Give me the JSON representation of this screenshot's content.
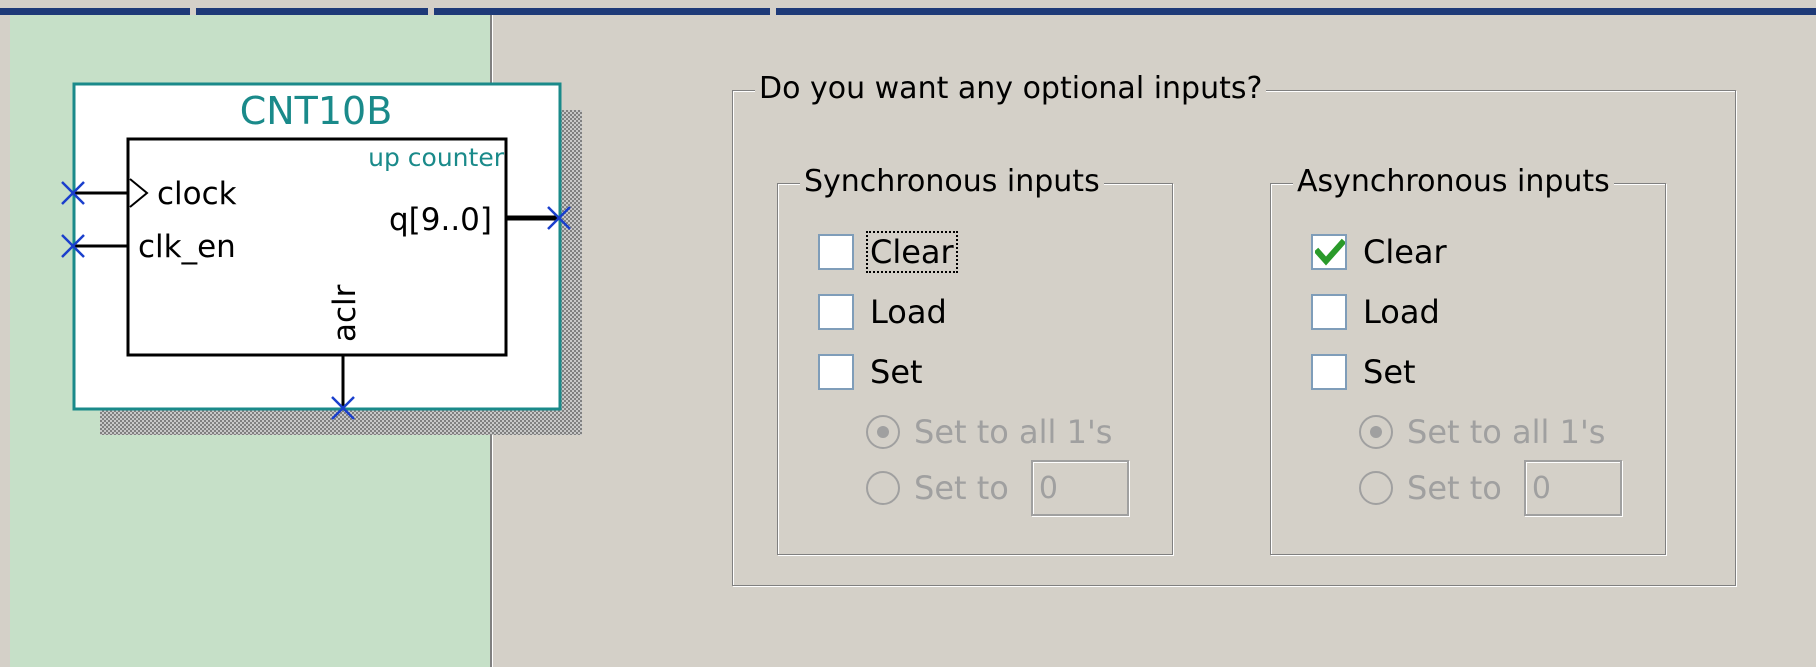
{
  "symbol": {
    "name": "CNT10B",
    "type": "up counter",
    "ports": {
      "clock": "clock",
      "clk_en": "clk_en",
      "output": "q[9..0]",
      "aclr": "aclr"
    }
  },
  "options": {
    "title": "Do you want any optional inputs?",
    "synchronous": {
      "title": "Synchronous inputs",
      "clear": {
        "label": "Clear",
        "checked": false
      },
      "load": {
        "label": "Load",
        "checked": false
      },
      "set": {
        "label": "Set",
        "checked": false
      },
      "set_all_ones": {
        "label": "Set to all 1's",
        "selected": true
      },
      "set_to": {
        "label": "Set to",
        "selected": false,
        "value": "0"
      }
    },
    "asynchronous": {
      "title": "Asynchronous inputs",
      "clear": {
        "label": "Clear",
        "checked": true
      },
      "load": {
        "label": "Load",
        "checked": false
      },
      "set": {
        "label": "Set",
        "checked": false
      },
      "set_all_ones": {
        "label": "Set to all 1's",
        "selected": true
      },
      "set_to": {
        "label": "Set to",
        "selected": false,
        "value": "0"
      }
    }
  },
  "colors": {
    "preview_background": "#c6e0c8",
    "symbol_border": "#1a8a8a",
    "symbol_text_teal": "#1a8a8a",
    "pin_marker": "#1a3fcc",
    "check_mark": "#2a9a2a",
    "dialog_background": "#d4d0c8"
  }
}
